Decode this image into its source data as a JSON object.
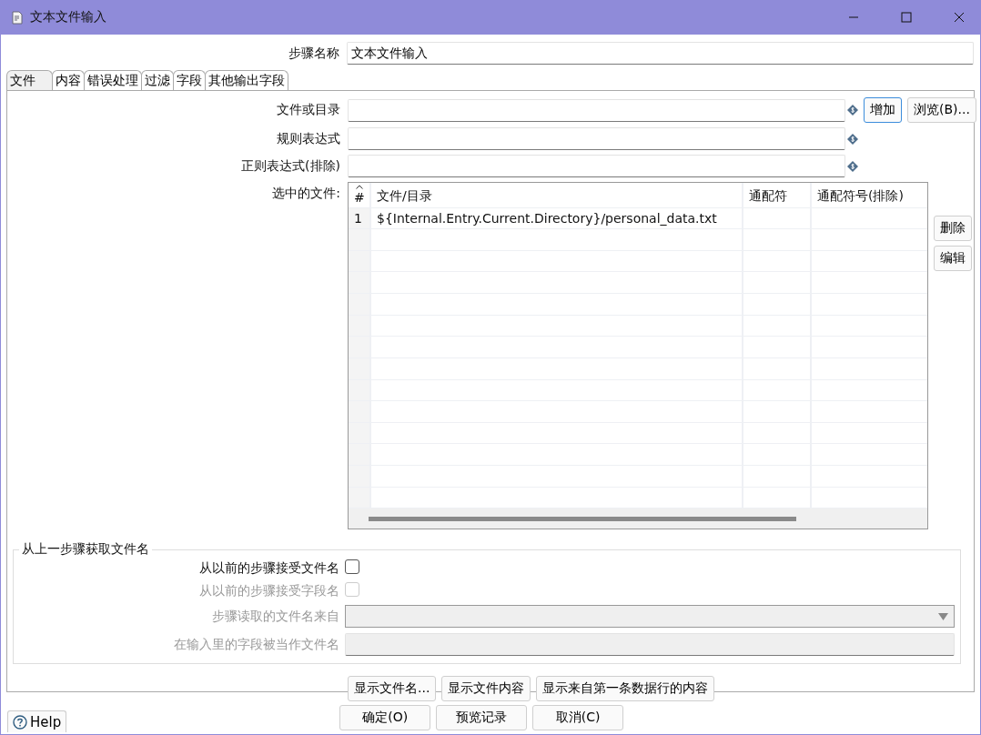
{
  "window": {
    "title": "文本文件输入"
  },
  "step_name": {
    "label": "步骤名称",
    "value": "文本文件输入"
  },
  "tabs": [
    {
      "label": "文件",
      "selected": true
    },
    {
      "label": "内容",
      "selected": false
    },
    {
      "label": "错误处理",
      "selected": false
    },
    {
      "label": "过滤",
      "selected": false
    },
    {
      "label": "字段",
      "selected": false
    },
    {
      "label": "其他输出字段",
      "selected": false
    }
  ],
  "file_fields": [
    {
      "label": "文件或目录",
      "buttons": [
        {
          "label": "增加",
          "focused": true
        },
        {
          "label": "浏览(B)...",
          "focused": false
        }
      ]
    },
    {
      "label": "规则表达式"
    },
    {
      "label": "正则表达式(排除)"
    }
  ],
  "selected_files": {
    "label": "选中的文件:",
    "columns": [
      "#",
      "文件/目录",
      "通配符",
      "通配符号(排除)"
    ],
    "rows": [
      {
        "number": "1",
        "path": "${Internal.Entry.Current.Directory}/personal_data.txt"
      }
    ],
    "side_buttons": [
      "删除",
      "编辑"
    ]
  },
  "previous_step": {
    "title": "从上一步骤获取文件名",
    "checks": [
      {
        "label": "从以前的步骤接受文件名",
        "checked": false,
        "disabled": false
      },
      {
        "label": "从以前的步骤接受字段名",
        "checked": false,
        "disabled": true
      }
    ],
    "step_source": {
      "label": "步骤读取的文件名来自",
      "disabled": true
    },
    "field_name": {
      "label": "在输入里的字段被当作文件名",
      "disabled": true
    }
  },
  "show_buttons": [
    "显示文件名...",
    "显示文件内容",
    "显示来自第一条数据行的内容"
  ],
  "help": "Help",
  "dialog_buttons": [
    "确定(O)",
    "预览记录",
    "取消(C)"
  ]
}
